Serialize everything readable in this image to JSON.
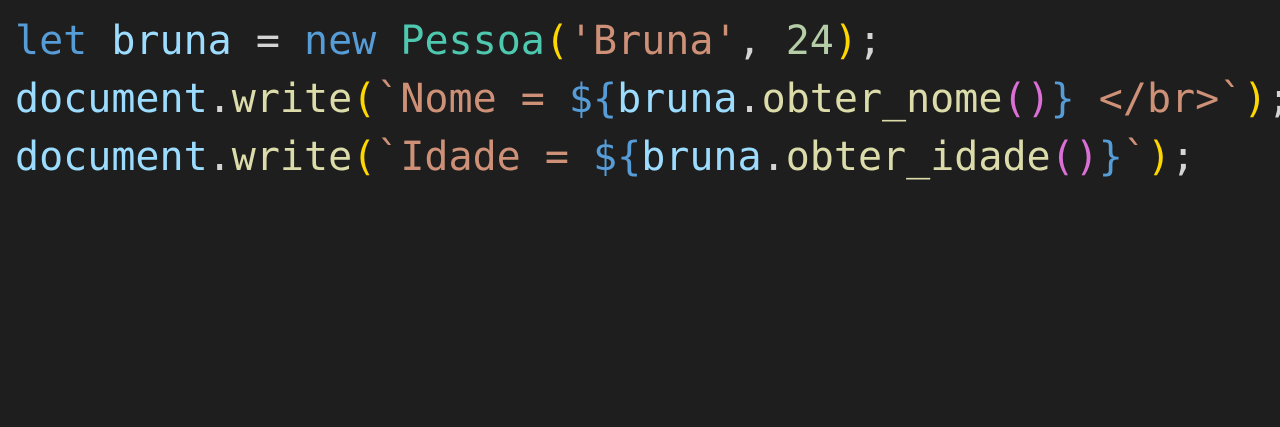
{
  "editor": {
    "lines": [
      {
        "tokens": [
          {
            "t": "let",
            "c": "#569cd6"
          },
          {
            "t": " ",
            "c": "#d4d4d4"
          },
          {
            "t": "bruna",
            "c": "#9cdcfe"
          },
          {
            "t": " = ",
            "c": "#d4d4d4"
          },
          {
            "t": "new",
            "c": "#569cd6"
          },
          {
            "t": " ",
            "c": "#d4d4d4"
          },
          {
            "t": "Pessoa",
            "c": "#4ec9b0"
          },
          {
            "t": "(",
            "c": "#ffd700"
          },
          {
            "t": "'Bruna'",
            "c": "#ce9178"
          },
          {
            "t": ", ",
            "c": "#d4d4d4"
          },
          {
            "t": "24",
            "c": "#b5cea8"
          },
          {
            "t": ")",
            "c": "#ffd700"
          },
          {
            "t": ";",
            "c": "#d4d4d4"
          }
        ]
      },
      {
        "tokens": [
          {
            "t": "document",
            "c": "#9cdcfe"
          },
          {
            "t": ".",
            "c": "#d4d4d4"
          },
          {
            "t": "write",
            "c": "#dcdcaa"
          },
          {
            "t": "(",
            "c": "#ffd700"
          },
          {
            "t": "`Nome = ",
            "c": "#ce9178"
          },
          {
            "t": "${",
            "c": "#569cd6"
          },
          {
            "t": "bruna",
            "c": "#9cdcfe"
          },
          {
            "t": ".",
            "c": "#d4d4d4"
          },
          {
            "t": "obter_nome",
            "c": "#dcdcaa"
          },
          {
            "t": "()",
            "c": "#da70d6"
          },
          {
            "t": "}",
            "c": "#569cd6"
          },
          {
            "t": " </br>`",
            "c": "#ce9178"
          },
          {
            "t": ")",
            "c": "#ffd700"
          },
          {
            "t": ";",
            "c": "#d4d4d4"
          }
        ]
      },
      {
        "tokens": [
          {
            "t": "document",
            "c": "#9cdcfe"
          },
          {
            "t": ".",
            "c": "#d4d4d4"
          },
          {
            "t": "write",
            "c": "#dcdcaa"
          },
          {
            "t": "(",
            "c": "#ffd700"
          },
          {
            "t": "`Idade = ",
            "c": "#ce9178"
          },
          {
            "t": "${",
            "c": "#569cd6"
          },
          {
            "t": "bruna",
            "c": "#9cdcfe"
          },
          {
            "t": ".",
            "c": "#d4d4d4"
          },
          {
            "t": "obter_idade",
            "c": "#dcdcaa"
          },
          {
            "t": "()",
            "c": "#da70d6"
          },
          {
            "t": "}",
            "c": "#569cd6"
          },
          {
            "t": "`",
            "c": "#ce9178"
          },
          {
            "t": ")",
            "c": "#ffd700"
          },
          {
            "t": ";",
            "c": "#d4d4d4"
          }
        ]
      }
    ]
  }
}
